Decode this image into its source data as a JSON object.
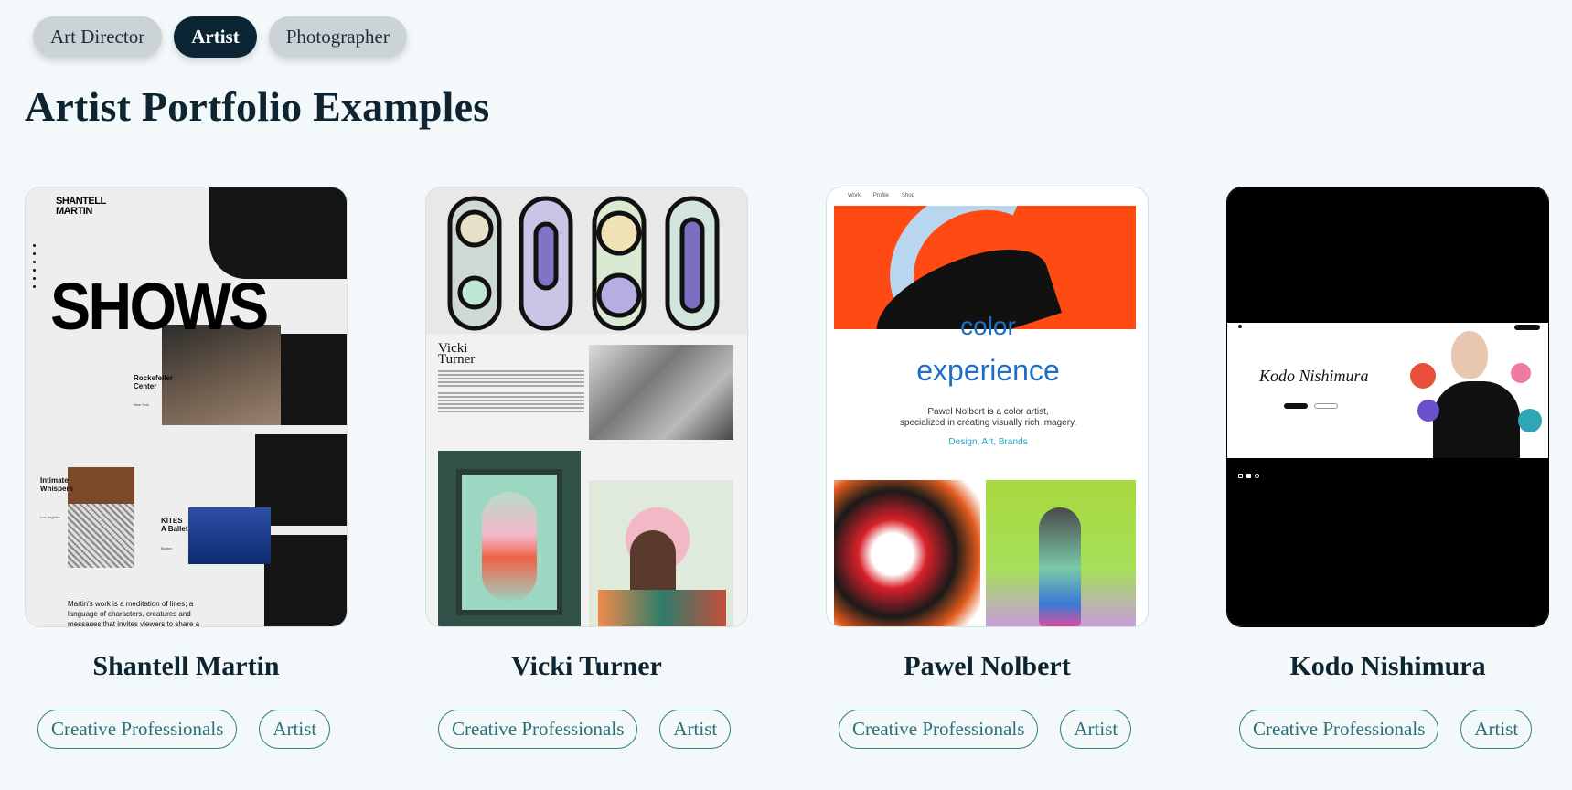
{
  "filters": [
    {
      "label": "Art Director",
      "active": false
    },
    {
      "label": "Artist",
      "active": true
    },
    {
      "label": "Photographer",
      "active": false
    }
  ],
  "heading": "Artist Portfolio Examples",
  "cards": [
    {
      "name": "Shantell Martin",
      "tags": [
        "Creative Professionals",
        "Artist"
      ],
      "thumb": {
        "logo": "SHANTELL MARTIN",
        "headline": "SHOWS",
        "item1": "Rockefeller Center",
        "item1_city": "New York",
        "item2": "Intimate Whispers",
        "item2_city": "Los Angeles",
        "item3": "KITES A Ballet",
        "item3_city": "Boston",
        "paragraph": "Martin's work is a meditation of lines; a language of characters, creatures and messages that invites viewers to share a role"
      }
    },
    {
      "name": "Vicki Turner",
      "tags": [
        "Creative Professionals",
        "Artist"
      ],
      "thumb": {
        "title": "Vicki Turner"
      }
    },
    {
      "name": "Pawel Nolbert",
      "tags": [
        "Creative Professionals",
        "Artist"
      ],
      "thumb": {
        "nav": [
          "Work",
          "Profile",
          "Shop"
        ],
        "line1": "color",
        "line2": "experience",
        "desc1": "Pawel Nolbert is a color artist,",
        "desc2": "specialized in creating visually rich imagery.",
        "links": "Design, Art, Brands"
      }
    },
    {
      "name": "Kodo Nishimura",
      "tags": [
        "Creative Professionals",
        "Artist"
      ],
      "thumb": {
        "signature": "Kodo Nishimura"
      }
    }
  ],
  "colors": {
    "background": "#f3f9fb",
    "chip_active": "#0b2433",
    "chip_inactive": "#ccd3d6",
    "tag_border": "#2f7e80",
    "heading": "#0e2430"
  }
}
